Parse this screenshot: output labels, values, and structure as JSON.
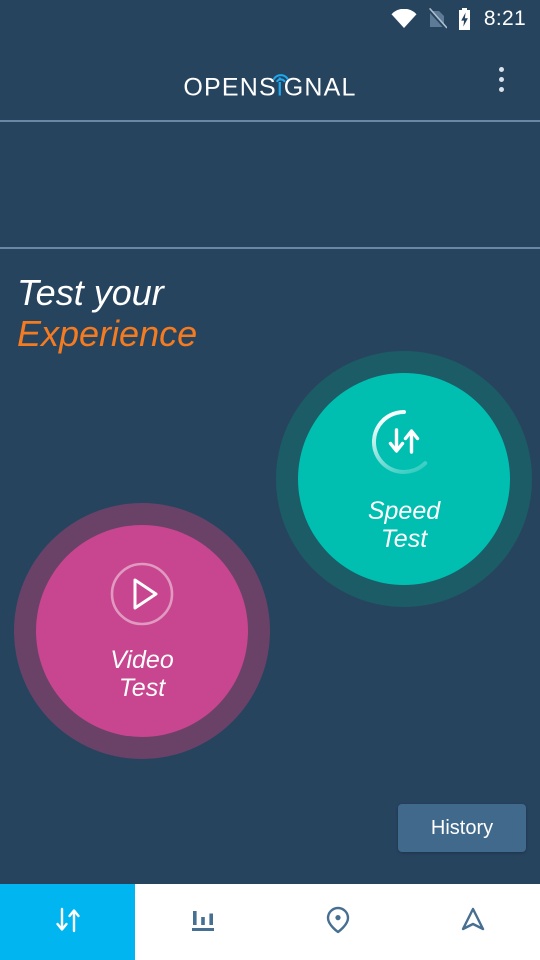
{
  "status_bar": {
    "time": "8:21",
    "icons": [
      "wifi-icon",
      "no-sim-icon",
      "battery-charging-icon"
    ]
  },
  "app_bar": {
    "logo_part1": "OPENS",
    "logo_letter_i": "i",
    "logo_part2": "GNAL",
    "overflow_menu": "more-options"
  },
  "banner": {
    "content": ""
  },
  "headline": {
    "line1": "Test your",
    "line2": "Experience"
  },
  "tests": {
    "speed": {
      "label_line1": "Speed",
      "label_line2": "Test",
      "icon": "speed-gauge-arrows-icon",
      "ring_color": "#1c5c66",
      "fill_color": "#00bfb1"
    },
    "video": {
      "label_line1": "Video",
      "label_line2": "Test",
      "icon": "play-circle-icon",
      "ring_color": "#6a4268",
      "fill_color": "#c8458f"
    }
  },
  "history_button": {
    "label": "History"
  },
  "bottom_nav": {
    "items": [
      {
        "name": "tests",
        "icon": "download-upload-arrows-icon",
        "active": true
      },
      {
        "name": "stats",
        "icon": "bar-chart-icon",
        "active": false
      },
      {
        "name": "coverage-map",
        "icon": "map-pin-icon",
        "active": false
      },
      {
        "name": "navigation",
        "icon": "navigation-arrow-icon",
        "active": false
      }
    ],
    "active_color": "#00b5f0",
    "inactive_color": "#476f92"
  },
  "colors": {
    "background": "#27445f",
    "accent_orange": "#f47b20",
    "accent_blue": "#1eaaf0"
  }
}
